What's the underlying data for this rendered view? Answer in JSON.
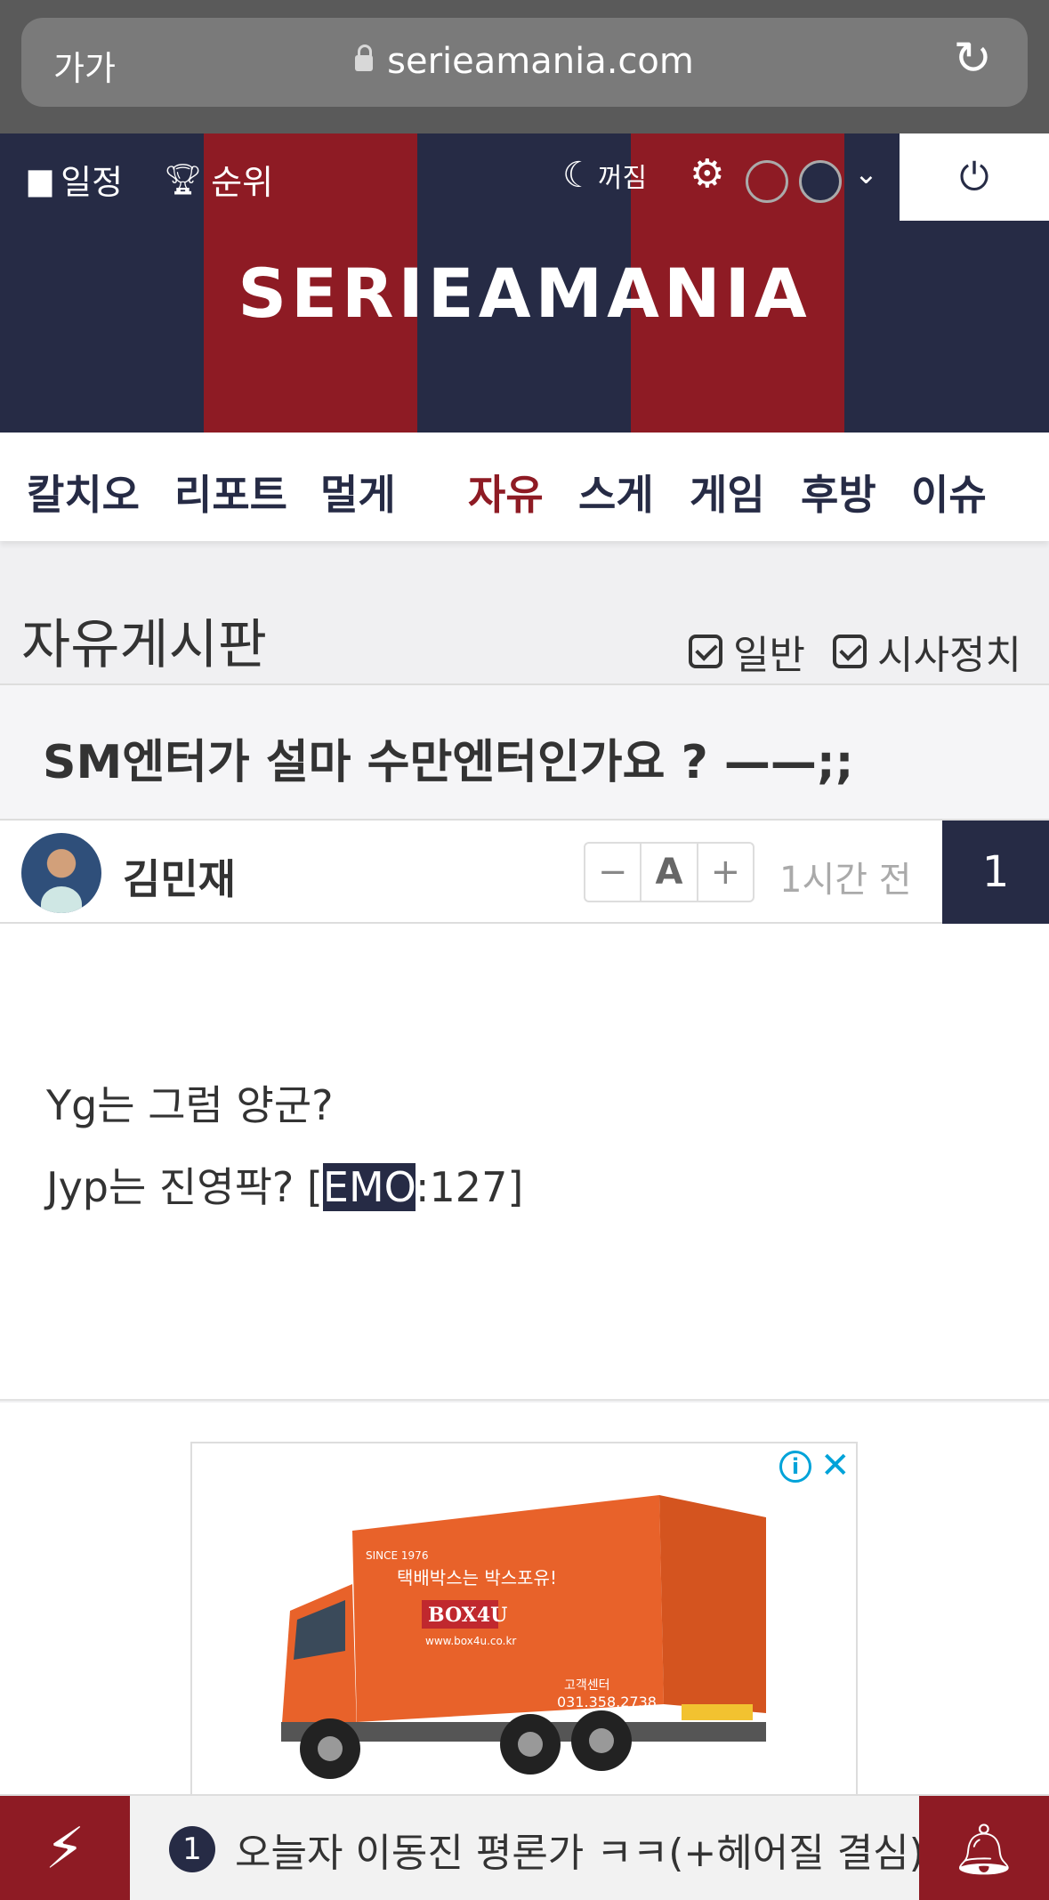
{
  "browser": {
    "text_size_label": "가가",
    "url": "serieamania.com"
  },
  "header": {
    "schedule_label": "일정",
    "ranking_label": "순위",
    "dark_mode_label": "꺼짐",
    "logo": "SERIEAMANIA",
    "theme_colors": [
      "#8e1b24",
      "#262b45"
    ]
  },
  "nav": {
    "items": [
      "칼치오",
      "리포트",
      "멀게",
      "자유",
      "스게",
      "게임",
      "후방",
      "이슈"
    ],
    "active": "자유"
  },
  "board": {
    "title": "자유게시판",
    "filters": [
      "일반",
      "시사정치"
    ]
  },
  "post": {
    "title": "SM엔터가 설마 수만엔터인가요 ? ——;;",
    "author": "김민재",
    "font_minus": "−",
    "font_a": "A",
    "font_plus": "+",
    "time": "1시간 전",
    "count": "1",
    "body_line1": "Yg는 그럼 양군?",
    "body_line2_pre": "Jyp는 진영팍? [",
    "body_line2_highlight": "EMO",
    "body_line2_post": ":127]"
  },
  "ad": {
    "info": "i",
    "close": "✕",
    "truck_slogan": "택배박스는 박스포유!",
    "truck_brand": "BOX4U",
    "truck_url": "www.box4u.co.kr",
    "truck_year": "SINCE 1976",
    "truck_phone": "031.358.2738",
    "truck_center": "고객센터"
  },
  "bottom": {
    "ticker_num": "1",
    "ticker_text": "오늘자 이동진 평론가 ㅋㅋ(+헤어질 결심)"
  }
}
